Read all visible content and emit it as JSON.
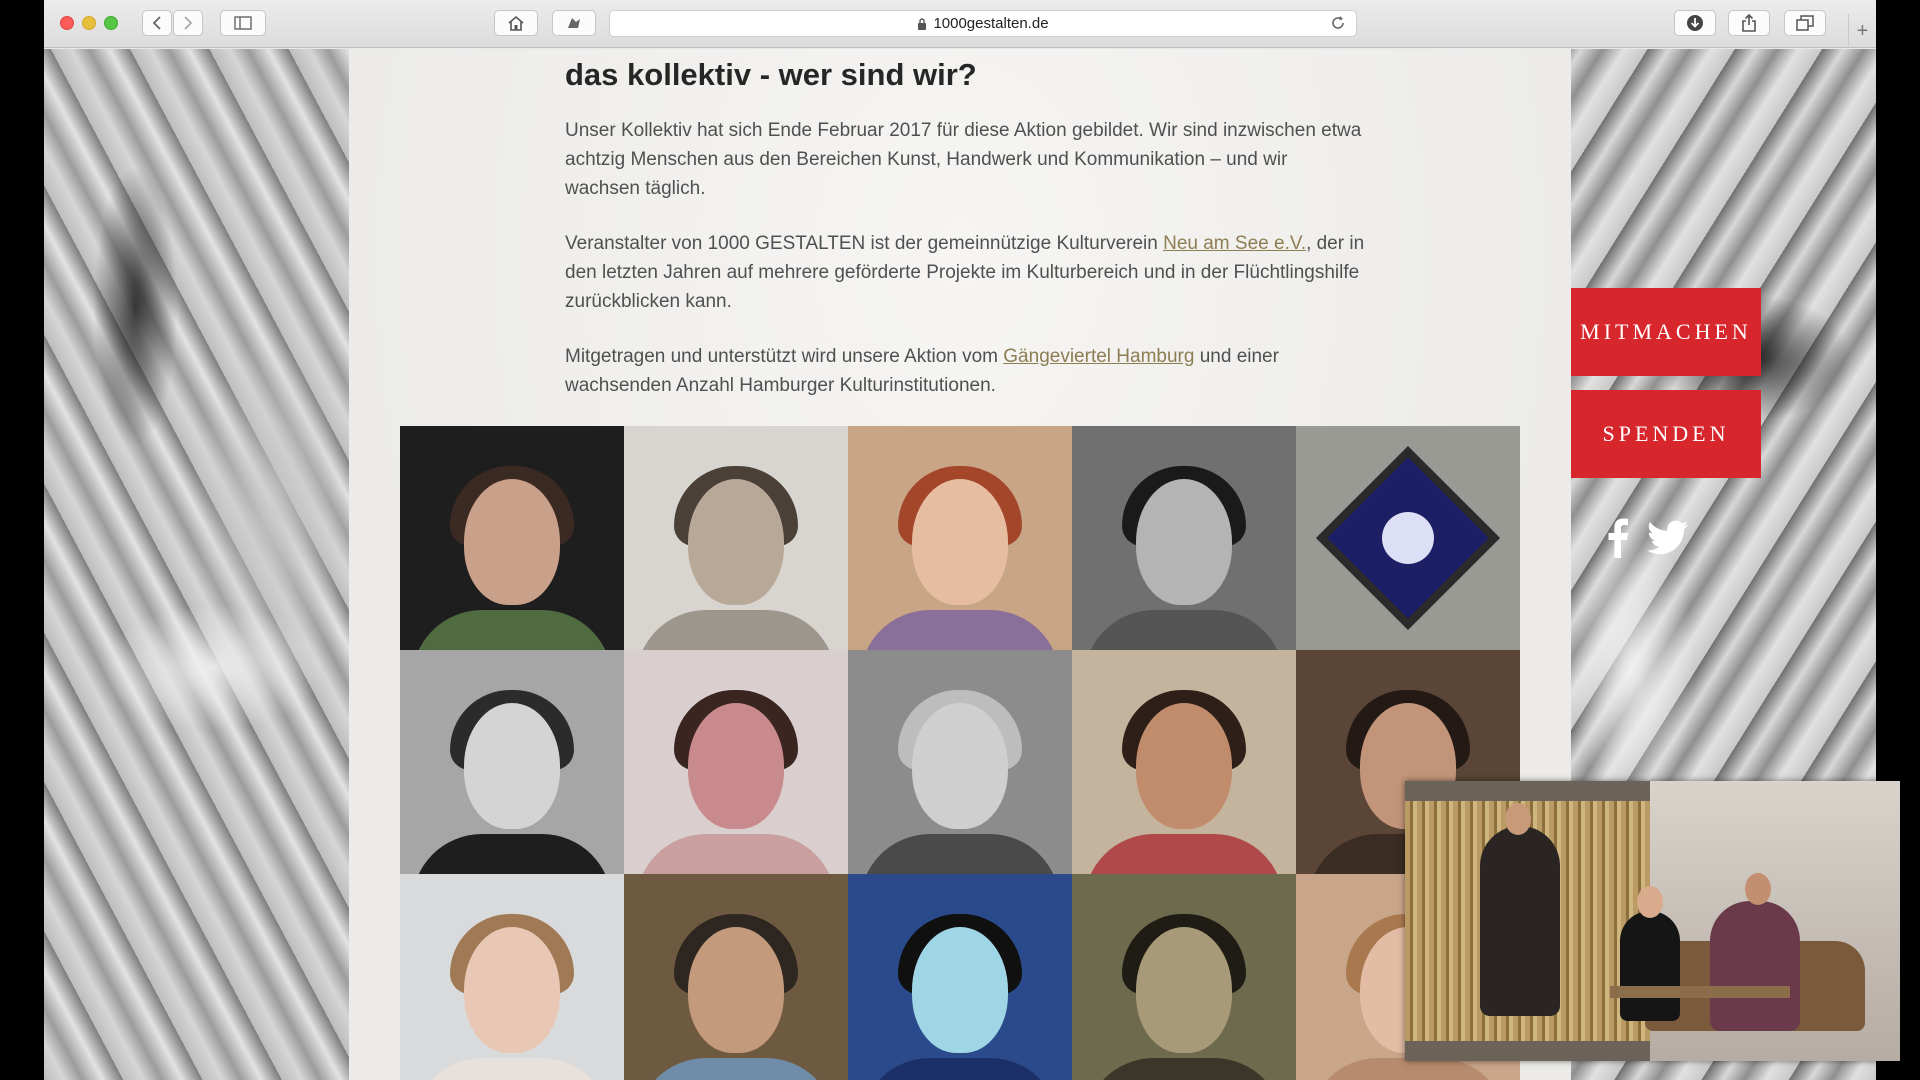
{
  "browser": {
    "url": "1000gestalten.de"
  },
  "page": {
    "heading": "das kollektiv - wer sind wir?",
    "paragraph1": "Unser Kollektiv hat sich Ende Februar 2017 für diese Aktion gebildet. Wir sind inzwischen etwa achtzig Menschen aus den Bereichen Kunst, Handwerk und Kommunikation – und wir wachsen täglich.",
    "paragraph2_before": "Veranstalter von 1000 GESTALTEN ist der gemeinnützige Kulturverein ",
    "paragraph2_link": "Neu am See e.V.",
    "paragraph2_after": ", der in den letzten Jahren auf mehrere geförderte Projekte im Kulturbereich und in der Flüchtlingshilfe zurückblicken kann.",
    "paragraph3_before": "Mitgetragen und unterstützt wird unsere Aktion vom ",
    "paragraph3_link": "Gängeviertel Hamburg",
    "paragraph3_after": " und einer wachsenden Anzahl Hamburger Kulturinstitutionen."
  },
  "sidebar": {
    "mitmachen_label": "MITMACHEN",
    "spenden_label": "SPENDEN",
    "social_icons": [
      "facebook-icon",
      "twitter-icon"
    ]
  },
  "colors": {
    "accent_red": "#d7262c",
    "link_color": "#8c7d52",
    "heading_color": "#262626",
    "text_color": "#505050"
  }
}
